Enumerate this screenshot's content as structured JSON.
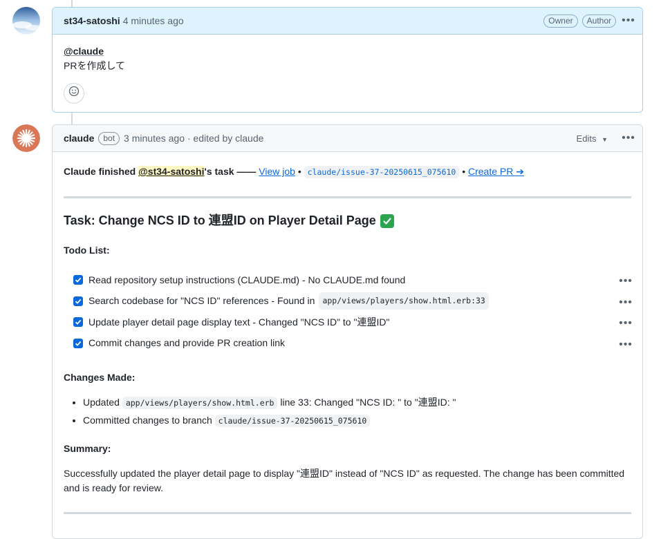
{
  "comment1": {
    "author": "st34-satoshi",
    "time": "4 minutes ago",
    "badges": [
      "Owner",
      "Author"
    ],
    "mention": "@claude",
    "text": "PRを作成して"
  },
  "comment2": {
    "author": "claude",
    "bot_badge": "bot",
    "time_meta": "3 minutes ago · edited by claude",
    "edits_label": "Edits",
    "status": {
      "prefix": "Claude finished",
      "mention": "@st34-satoshi",
      "suffix": "'s task ——",
      "view_job": "View job",
      "sep": "•",
      "branch": "claude/issue-37-20250615_075610",
      "create_pr": "Create PR ➔"
    },
    "task_title": "Task: Change NCS ID to 連盟ID on Player Detail Page",
    "todo_heading": "Todo List:",
    "todos": [
      {
        "text": "Read repository setup instructions (CLAUDE.md) - No CLAUDE.md found",
        "code": "",
        "checked": true
      },
      {
        "text": "Search codebase for \"NCS ID\" references - Found in",
        "code": "app/views/players/show.html.erb:33",
        "checked": true
      },
      {
        "text": "Update player detail page display text - Changed \"NCS ID\" to \"連盟ID\"",
        "code": "",
        "checked": true
      },
      {
        "text": "Commit changes and provide PR creation link",
        "code": "",
        "checked": true
      }
    ],
    "changes_heading": "Changes Made:",
    "changes": [
      {
        "prefix": "Updated",
        "code": "app/views/players/show.html.erb",
        "suffix": "line 33: Changed \"NCS ID: \" to \"連盟ID: \""
      },
      {
        "prefix": "Committed changes to branch",
        "code": "claude/issue-37-20250615_075610",
        "suffix": ""
      }
    ],
    "summary_heading": "Summary:",
    "summary": "Successfully updated the player detail page to display \"連盟ID\" instead of \"NCS ID\" as requested. The change has been committed and is ready for review."
  },
  "colors": {
    "link": "#0969da",
    "owner_header_bg": "#ddf4ff",
    "checkbox": "#0969da",
    "claude_brand": "#d97757",
    "mention_highlight": "#fff8c5"
  },
  "icons": [
    "kebab-icon",
    "smiley-icon",
    "caret-down-icon",
    "checkbox-icon",
    "check-mark-emoji-icon"
  ]
}
